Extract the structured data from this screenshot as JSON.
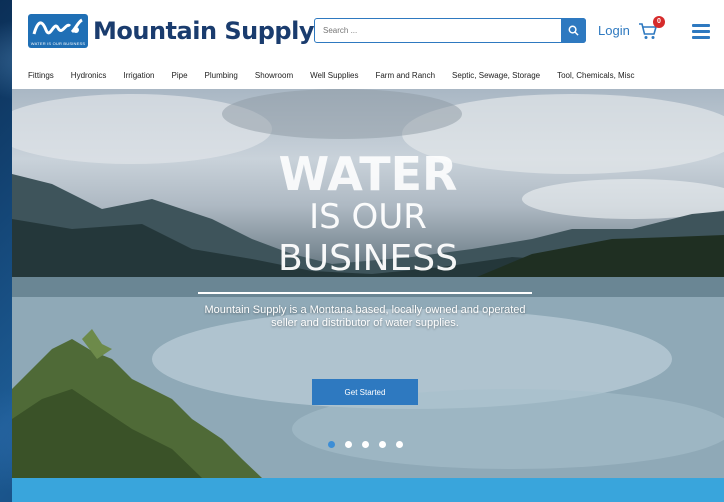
{
  "brand": {
    "name": "Mountain Supply",
    "tagline": "WATER IS OUR BUSINESS",
    "logo_color": "#1f6fb5"
  },
  "header": {
    "search_placeholder": "Search ...",
    "login_label": "Login",
    "cart_count": "0",
    "icons": [
      "search-icon",
      "cart-icon",
      "hamburger-menu-icon"
    ]
  },
  "nav": {
    "items": [
      "Fittings",
      "Hydronics",
      "Irrigation",
      "Pipe",
      "Plumbing",
      "Showroom",
      "Well Supplies",
      "Farm and Ranch",
      "Septic, Sewage, Storage",
      "Tool, Chemicals, Misc"
    ]
  },
  "hero": {
    "line1": "WATER",
    "line2": "IS OUR",
    "line3": "BUSINESS",
    "description": "Mountain Supply is a Montana based, locally owned and operated seller and distributor of water supplies.",
    "cta_label": "Get Started",
    "slides_total": 5,
    "active_slide": 1
  },
  "colors": {
    "accent": "#2e79c0",
    "badge": "#d62b2b",
    "band": "#39a5dc"
  }
}
